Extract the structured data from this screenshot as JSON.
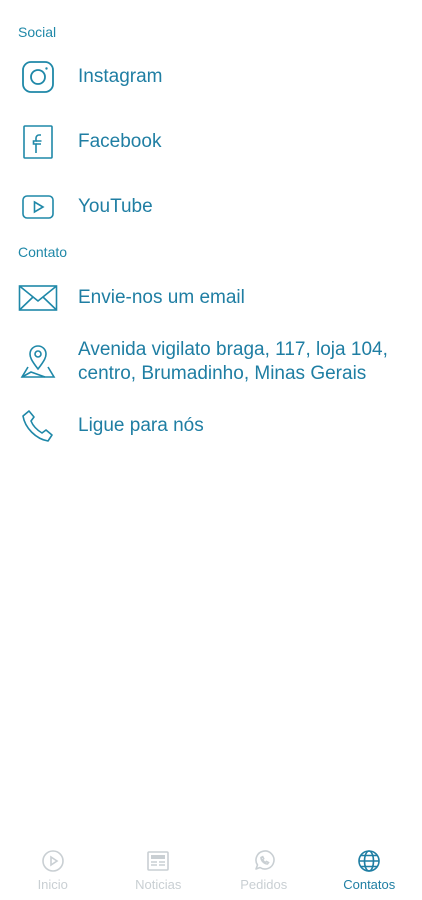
{
  "colors": {
    "accent": "#1f7ea3",
    "inactive": "#c9cfd3"
  },
  "sections": {
    "social": "Social",
    "contato": "Contato"
  },
  "social_items": [
    {
      "label": "Instagram",
      "icon": "instagram-icon"
    },
    {
      "label": "Facebook",
      "icon": "facebook-icon"
    },
    {
      "label": "YouTube",
      "icon": "youtube-icon"
    }
  ],
  "contact_items": [
    {
      "label": "Envie-nos um email",
      "icon": "mail-icon"
    },
    {
      "label": "Avenida vigilato braga, 117, loja 104, centro, Brumadinho, Minas Gerais",
      "icon": "map-pin-icon"
    },
    {
      "label": "Ligue para nós",
      "icon": "phone-icon"
    }
  ],
  "bottom_nav": {
    "tabs": [
      {
        "label": "Inicio",
        "icon": "play-circle-icon",
        "active": false
      },
      {
        "label": "Noticias",
        "icon": "newspaper-icon",
        "active": false
      },
      {
        "label": "Pedidos",
        "icon": "whatsapp-icon",
        "active": false
      },
      {
        "label": "Contatos",
        "icon": "globe-icon",
        "active": true
      }
    ]
  }
}
